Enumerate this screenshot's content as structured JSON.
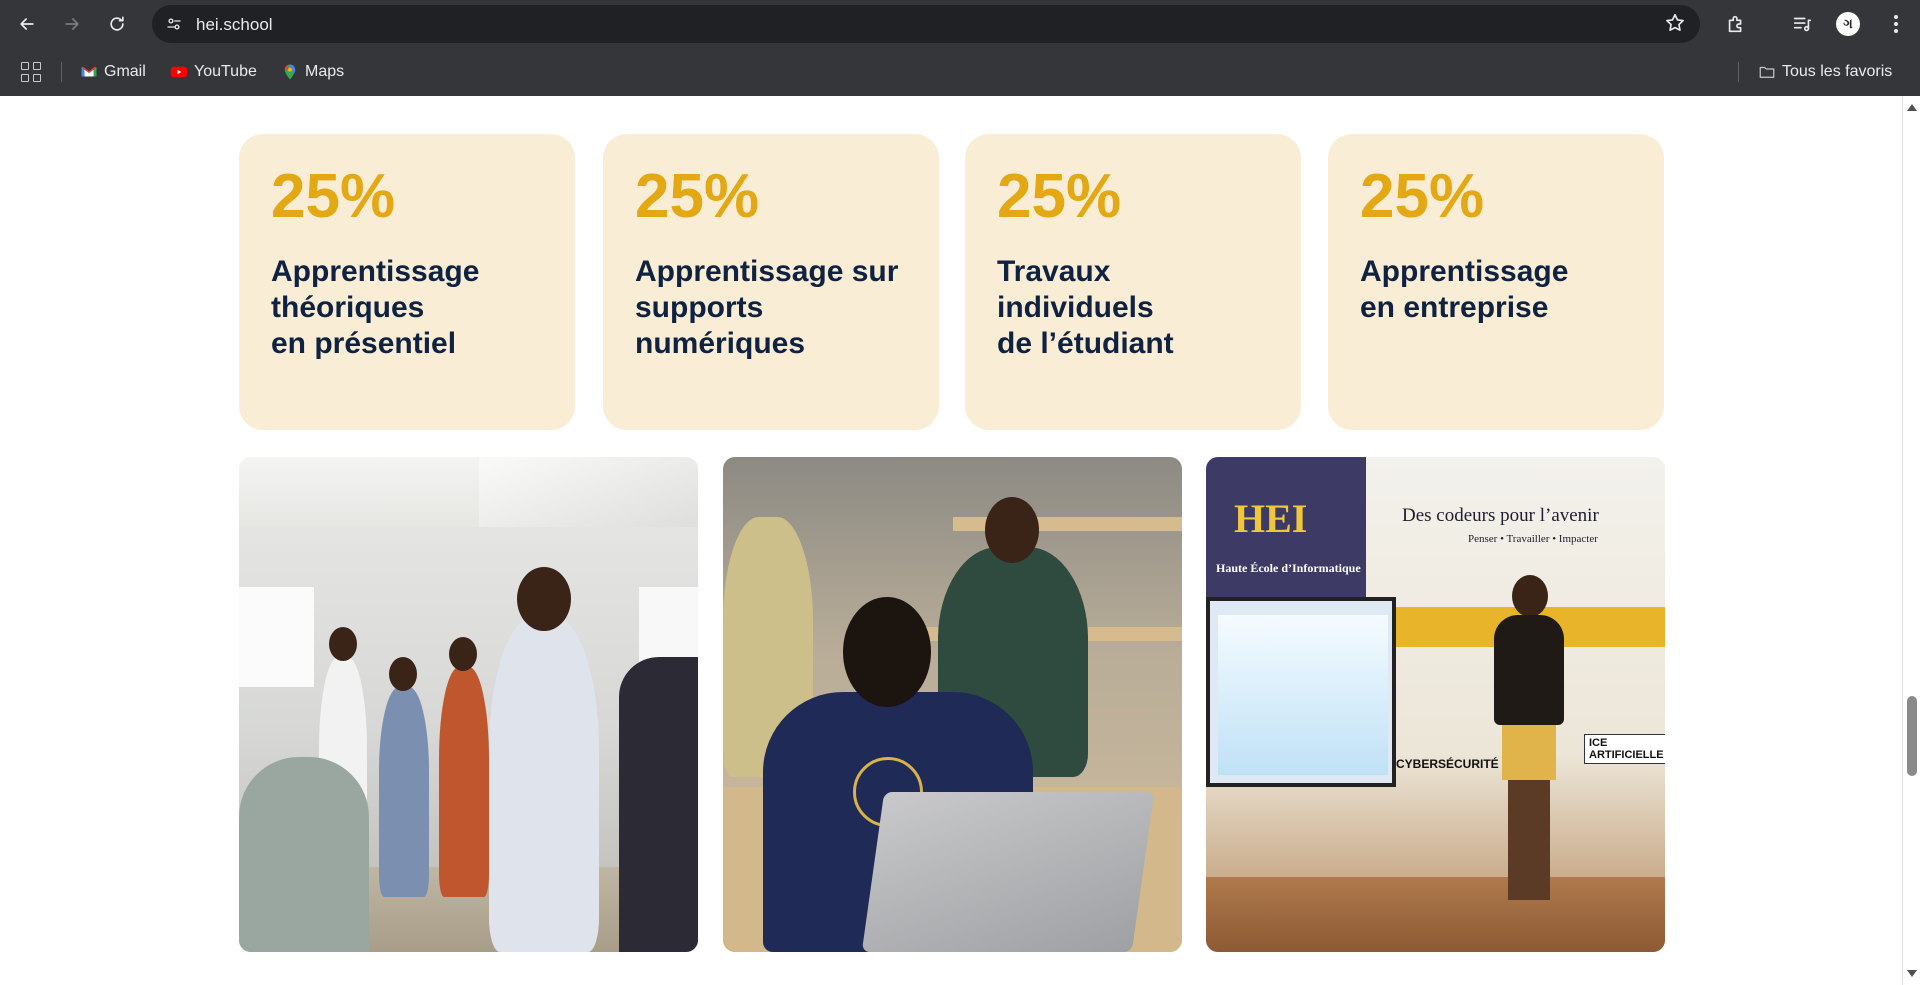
{
  "browser": {
    "url": "hei.school",
    "bookmarks": [
      {
        "label": "Gmail",
        "icon": "gmail-icon"
      },
      {
        "label": "YouTube",
        "icon": "youtube-icon"
      },
      {
        "label": "Maps",
        "icon": "maps-icon"
      }
    ],
    "all_bookmarks_label": "Tous les favoris",
    "profile_initial": "ગ"
  },
  "stats": [
    {
      "percent": "25%",
      "label": "Apprentissage\nthéoriques\nen présentiel"
    },
    {
      "percent": "25%",
      "label": "Apprentissage sur\nsupports\nnumériques"
    },
    {
      "percent": "25%",
      "label": "Travaux\nindividuels\nde l’étudiant"
    },
    {
      "percent": "25%",
      "label": "Apprentissage\nen entreprise"
    }
  ],
  "photos": {
    "banner": {
      "brand": "HEI",
      "brand_subtitle": "Haute École d’Informatique",
      "tagline": "Des codeurs pour l’avenir",
      "tagline_sub": "Penser • Travailler • Impacter",
      "topic_security": "CYBERSÉCURITÉ",
      "topic_ai": "ICE ARTIFICIELLE"
    }
  },
  "colors": {
    "card_bg": "#f9eed5",
    "percent": "#e3a814",
    "label": "#0f2241",
    "chrome": "#35363a"
  }
}
